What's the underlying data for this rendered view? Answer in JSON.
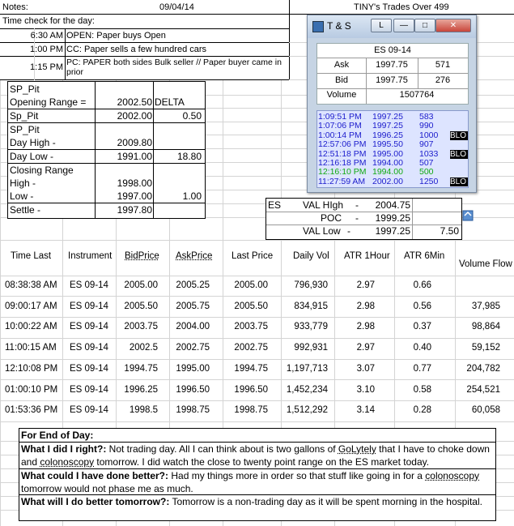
{
  "header": {
    "notes_label": "Notes:",
    "date": "09/04/14",
    "tiny_title": "TINY's Trades Over 499"
  },
  "time_check": {
    "label": "Time check for the day:",
    "entries": [
      {
        "time": "6:30 AM",
        "text": "OPEN: Paper buys Open"
      },
      {
        "time": "1:00 PM",
        "text": "CC: Paper sells a few hundred cars"
      },
      {
        "time": "1:15 PM",
        "text": "PC:  PAPER both sides Bulk seller // Paper buyer came in prior"
      }
    ]
  },
  "sp_pit": {
    "title1": "SP_Pit",
    "opening_range_label": "Opening Range =",
    "opening_range_value": "2002.50",
    "delta_label": "DELTA",
    "sp_pit_label": "Sp_Pit",
    "sp_pit_value": "2002.00",
    "delta_value": "0.50",
    "title2": "SP_Pit",
    "day_high_label": "Day High -",
    "day_high_value": "2009.80",
    "day_low_label": "Day Low -",
    "day_low_value": "1991.00",
    "range_value": "18.80",
    "closing_range_label": "Closing Range",
    "high_label": "High -",
    "high_value": "1998.00",
    "low_label": "Low -",
    "low_value": "1997.00",
    "closing_diff": "1.00",
    "settle_label": "Settle -",
    "settle_value": "1997.80"
  },
  "ts_window": {
    "title": "T & S",
    "btn_l": "L",
    "btn_min": "—",
    "btn_max": "□",
    "btn_close": "✕",
    "symbol": "ES 09-14",
    "ask_label": "Ask",
    "ask_price": "1997.75",
    "ask_size": "571",
    "bid_label": "Bid",
    "bid_price": "1997.75",
    "bid_size": "276",
    "volume_label": "Volume",
    "volume": "1507764",
    "trades": [
      {
        "time": "1:09:51 PM",
        "price": "1997.25",
        "size": "583",
        "tag": "",
        "color": "#1c1ccc"
      },
      {
        "time": "1:07:06 PM",
        "price": "1997.25",
        "size": "990",
        "tag": "",
        "color": "#1c1ccc"
      },
      {
        "time": "1:00:14 PM",
        "price": "1996.25",
        "size": "1000",
        "tag": "BLO",
        "color": "#1c1ccc"
      },
      {
        "time": "12:57:06 PM",
        "price": "1995.50",
        "size": "907",
        "tag": "",
        "color": "#1c1ccc"
      },
      {
        "time": "12:51:18 PM",
        "price": "1995.00",
        "size": "1033",
        "tag": "BLO",
        "color": "#1c1ccc"
      },
      {
        "time": "12:16:18 PM",
        "price": "1994.00",
        "size": "507",
        "tag": "",
        "color": "#1c1ccc"
      },
      {
        "time": "12:16:10 PM",
        "price": "1994.00",
        "size": "500",
        "tag": "",
        "color": "#11aa11"
      },
      {
        "time": "11:27:59 AM",
        "price": "2002.00",
        "size": "1250",
        "tag": "BLO",
        "color": "#1c1ccc"
      }
    ]
  },
  "val": {
    "es_label": "ES",
    "val_high_label": "VAL HIgh",
    "val_high_dash": "-",
    "val_high_value": "2004.75",
    "poc_label": "POC",
    "poc_dash": "-",
    "poc_value": "1999.25",
    "val_low_label": "VAL Low",
    "val_low_dash": "-",
    "val_low_value": "1997.25",
    "range": "7.50"
  },
  "table": {
    "headers": [
      "Time Last",
      "Instrument",
      "BidPrice",
      "AskPrice",
      "Last Price",
      "Daily Vol",
      "ATR 1Hour",
      "ATR 6Min",
      "Volume Flow"
    ],
    "rows": [
      [
        "08:38:38 AM",
        "ES 09-14",
        "2005.00",
        "2005.25",
        "2005.00",
        "796,930",
        "2.97",
        "0.66",
        ""
      ],
      [
        "09:00:17 AM",
        "ES 09-14",
        "2005.50",
        "2005.75",
        "2005.50",
        "834,915",
        "2.98",
        "0.56",
        "37,985"
      ],
      [
        "10:00:22 AM",
        "ES 09-14",
        "2003.75",
        "2004.00",
        "2003.75",
        "933,779",
        "2.98",
        "0.37",
        "98,864"
      ],
      [
        "11:00:15 AM",
        "ES 09-14",
        "2002.5",
        "2002.75",
        "2002.75",
        "992,931",
        "2.97",
        "0.40",
        "59,152"
      ],
      [
        "12:10:08 PM",
        "ES 09-14",
        "1994.75",
        "1995.00",
        "1994.75",
        "1,197,713",
        "3.07",
        "0.77",
        "204,782"
      ],
      [
        "01:00:10 PM",
        "ES 09-14",
        "1996.25",
        "1996.50",
        "1996.50",
        "1,452,234",
        "3.10",
        "0.58",
        "254,521"
      ],
      [
        "01:53:36 PM",
        "ES 09-14",
        "1998.5",
        "1998.75",
        "1998.75",
        "1,512,292",
        "3.14",
        "0.28",
        "60,058"
      ]
    ]
  },
  "end_of_day": {
    "heading": "For End of Day:",
    "q1": "What I did I right?:",
    "a1_part1": "  Not trading day.  All I can think about is two gallons of ",
    "a1_golytely": "GoLytely",
    "a1_part2": " that I have to choke down and ",
    "a1_colon": "colonoscopy",
    "a1_part3": " tomorrow.  I did watch the close to twenty point range on the ES market today.",
    "q2": "What could I have done better?:",
    "a2_part1": "  Had my things more in order so that stuff like going in for a ",
    "a2_colon": "colonoscopy",
    "a2_part2": " tomorrow would not phase me as much.",
    "q3": "What will I do better tomorrow?:",
    "a3": "  Tomorrow is a non-trading day as it will be spent morning in the hospital."
  }
}
